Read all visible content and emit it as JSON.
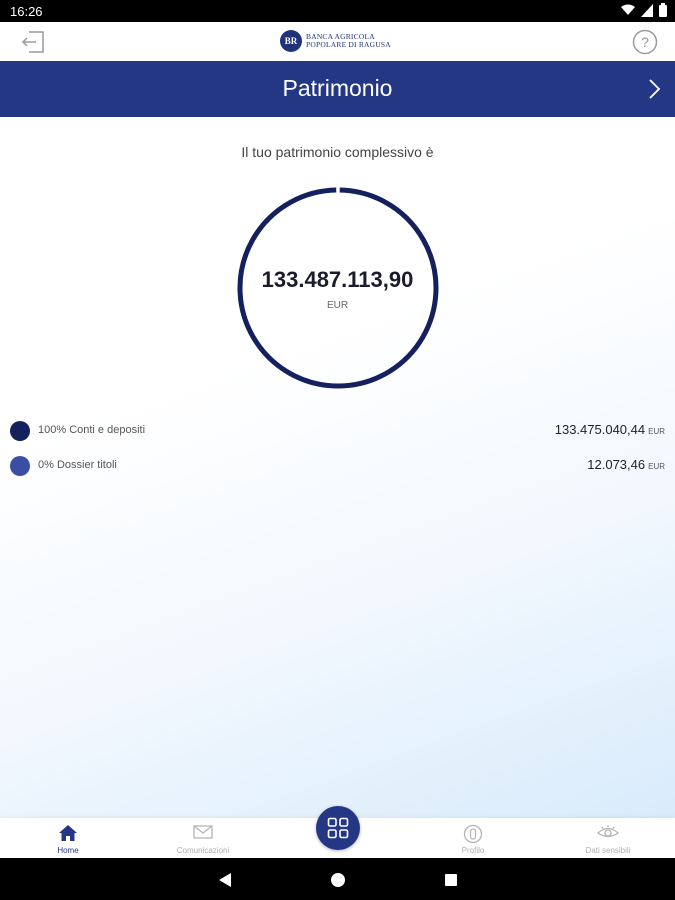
{
  "status_bar": {
    "time": "16:26"
  },
  "header": {
    "logo_mark": "BR",
    "logo_line1": "BANCA AGRICOLA",
    "logo_line2": "POPOLARE DI RAGUSA"
  },
  "title_bar": {
    "title": "Patrimonio"
  },
  "summary": {
    "subtitle": "Il tuo patrimonio complessivo è",
    "total": "133.487.113,90",
    "currency": "EUR"
  },
  "chart_data": {
    "type": "pie",
    "categories": [
      "Conti e depositi",
      "Dossier titoli"
    ],
    "values": [
      133475040.44,
      12073.46
    ]
  },
  "legend": [
    {
      "label": "100% Conti e depositi",
      "value": "133.475.040,44",
      "currency": "EUR",
      "color": "#15205e"
    },
    {
      "label": "0% Dossier titoli",
      "value": "12.073,46",
      "currency": "EUR",
      "color": "#3a4fa3"
    }
  ],
  "bottom_nav": [
    {
      "label": "Home",
      "icon": "home-icon"
    },
    {
      "label": "Comunicazioni",
      "icon": "mail-icon"
    },
    {
      "label": "Profilo",
      "icon": "profile-icon"
    },
    {
      "label": "Dati sensibili",
      "icon": "eye-icon"
    }
  ],
  "colors": {
    "primary": "#233785",
    "ring": "#15205e"
  }
}
